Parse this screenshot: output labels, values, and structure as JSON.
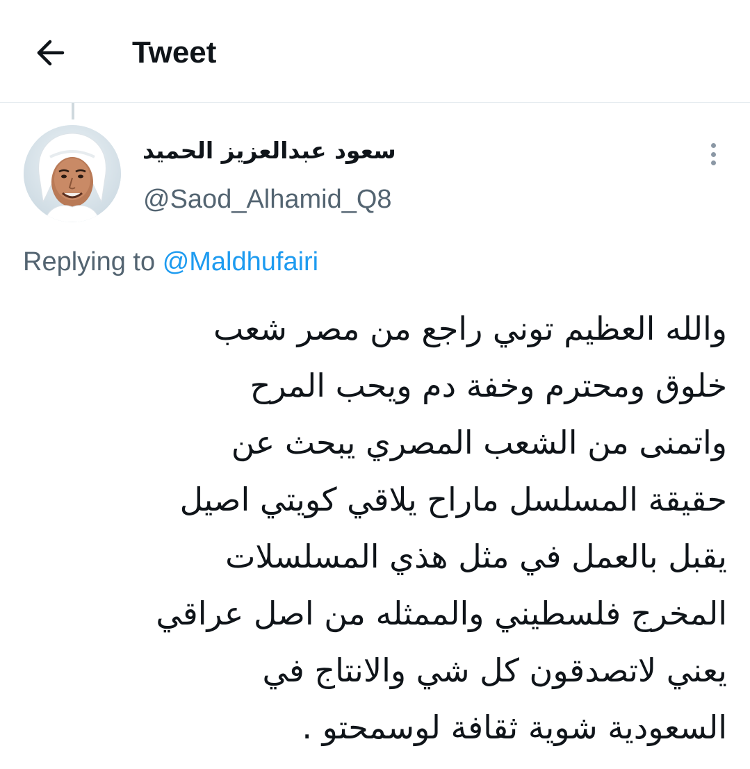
{
  "header": {
    "title": "Tweet",
    "back_icon": "arrow-left-icon"
  },
  "tweet": {
    "author": {
      "display_name": "سعود عبدالعزيز الحميد",
      "handle": "@Saod_Alhamid_Q8",
      "avatar": "profile-photo"
    },
    "more_icon": "more-vertical-icon",
    "replying_to": {
      "prefix": "Replying to",
      "user": "@Maldhufairi"
    },
    "body_lines": [
      "والله العظيم توني راجع من مصر شعب",
      "خلوق ومحترم وخفة دم ويحب المرح",
      "واتمنى من الشعب المصري يبحث عن",
      "حقيقة المسلسل ماراح يلاقي كويتي اصيل",
      "يقبل بالعمل في مثل هذي المسلسلات",
      "المخرج فلسطيني والممثله من اصل عراقي",
      "يعني لاتصدقون كل شي والانتاج في",
      "السعودية شوية ثقافة لوسمحتو ."
    ]
  },
  "colors": {
    "text_primary": "#0f1419",
    "text_secondary": "#536471",
    "link": "#1d9bf0",
    "divider": "#e6ecf0"
  }
}
